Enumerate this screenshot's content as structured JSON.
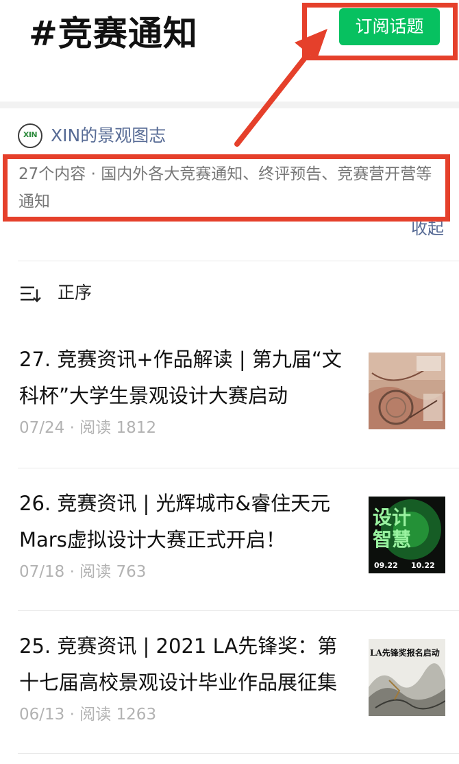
{
  "topic": {
    "title": "#竞赛通知",
    "subscribe_label": "订阅话题"
  },
  "account": {
    "avatar_text": "XIN",
    "name": "XIN的景观图志"
  },
  "description": "27个内容 · 国内外各大竞赛通知、终评预告、竞赛营开营等通知",
  "collapse_label": "收起",
  "sort_label": "正序",
  "articles": [
    {
      "title": "27. 竞赛资讯+作品解读 | 第九届“文科杯”大学生景观设计大赛启动",
      "date": "07/24",
      "reads": "阅读 1812",
      "thumb": "landscape-map-thumbnail"
    },
    {
      "title": "26. 竞赛资讯 | 光辉城市&睿住天元Mars虚拟设计大赛正式开启！",
      "date": "07/18",
      "reads": "阅读 763",
      "thumb": "design-contest-poster-thumbnail"
    },
    {
      "title": "25. 竞赛资讯 | 2021 LA先锋奖：第十七届高校景观设计毕业作品展征集",
      "date": "06/13",
      "reads": "阅读 1263",
      "thumb": "ink-landscape-poster-thumbnail"
    }
  ],
  "thumb_text": {
    "a2_line1": "设计",
    "a2_line2": "智慧",
    "a2_d1": "09.22",
    "a2_d2": "10.22",
    "a3_top": "LA先锋奖报名启动"
  },
  "colors": {
    "accent_green": "#07c160",
    "link_blue": "#576b95",
    "annotation_red": "#e5402b",
    "meta_gray": "#b2b2b2"
  }
}
